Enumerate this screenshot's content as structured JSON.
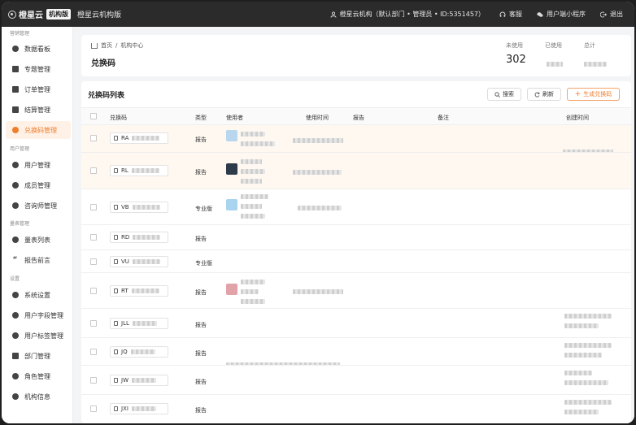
{
  "topbar": {
    "logo_text": "橙星云",
    "edition_badge": "机构版",
    "app_name": "橙星云机构版",
    "account": "橙星云机构（默认部门 • 管理员 • ID:5351457）",
    "service": "客服",
    "miniapp": "用户端小程序",
    "logout": "退出"
  },
  "sidebar": {
    "sections": [
      "营销管理",
      "用户管理",
      "量表管理",
      "设置"
    ],
    "items": [
      {
        "label": "数据看板",
        "icon": "pie-chart-icon"
      },
      {
        "label": "专题管理",
        "icon": "list-icon"
      },
      {
        "label": "订单管理",
        "icon": "document-icon"
      },
      {
        "label": "结算管理",
        "icon": "grid-icon"
      },
      {
        "label": "兑换码管理",
        "icon": "exchange-icon",
        "active": true
      },
      {
        "label": "用户管理",
        "icon": "users-icon"
      },
      {
        "label": "成员管理",
        "icon": "member-icon"
      },
      {
        "label": "咨询师管理",
        "icon": "counselor-icon"
      },
      {
        "label": "量表列表",
        "icon": "scale-icon"
      },
      {
        "label": "报告前言",
        "icon": "quote-icon"
      },
      {
        "label": "系统设置",
        "icon": "settings-icon"
      },
      {
        "label": "用户字段管理",
        "icon": "field-icon"
      },
      {
        "label": "用户标签管理",
        "icon": "tag-icon"
      },
      {
        "label": "部门管理",
        "icon": "org-icon"
      },
      {
        "label": "角色管理",
        "icon": "shield-icon"
      },
      {
        "label": "机构信息",
        "icon": "info-icon"
      }
    ]
  },
  "header": {
    "breadcrumb_home": "首页",
    "breadcrumb_sep": "/",
    "breadcrumb_current": "机构中心",
    "title": "兑换码",
    "stats": [
      {
        "label": "未使用",
        "value": "302"
      },
      {
        "label": "已使用",
        "value": ""
      },
      {
        "label": "总计",
        "value": ""
      }
    ]
  },
  "list": {
    "title": "兑换码列表",
    "search_label": "搜索",
    "refresh_label": "刷新",
    "generate_label": "生成兑换码",
    "columns": [
      "兑换码",
      "类型",
      "使用者",
      "使用时间",
      "报告",
      "备注",
      "创建时间"
    ],
    "rows": [
      {
        "code": "RA",
        "type": "报告"
      },
      {
        "code": "RL",
        "type": "报告"
      },
      {
        "code": "VB",
        "type": "专业版"
      },
      {
        "code": "RD",
        "type": "报告"
      },
      {
        "code": "VU",
        "type": "专业版"
      },
      {
        "code": "RT",
        "type": "报告"
      },
      {
        "code": "JLL",
        "type": "报告"
      },
      {
        "code": "JQ",
        "type": "报告"
      },
      {
        "code": "JW",
        "type": "报告"
      },
      {
        "code": "JXI",
        "type": "报告"
      }
    ]
  },
  "colors": {
    "accent": "#f07d2c",
    "topbar": "#2b2b2b",
    "active_bg": "#fff1e6"
  }
}
